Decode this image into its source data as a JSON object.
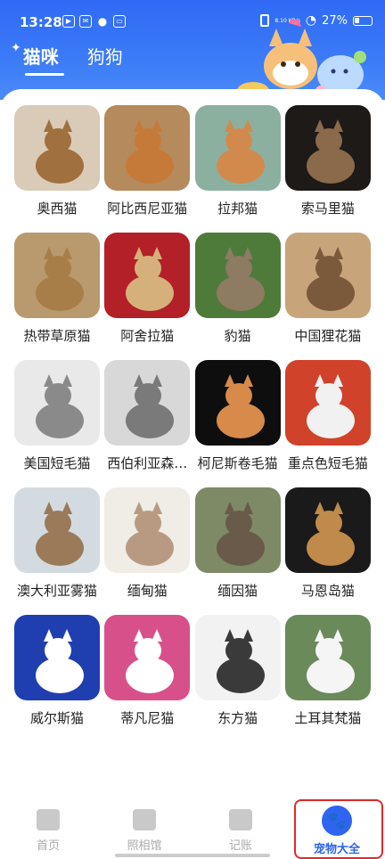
{
  "status_bar": {
    "time": "13:28",
    "net_speed": "8.10 KB/s",
    "battery": "27%"
  },
  "tabs": [
    {
      "label": "猫咪",
      "active": true
    },
    {
      "label": "狗狗",
      "active": false
    }
  ],
  "cats": [
    {
      "name": "奥西猫",
      "colors": [
        "#d9cbb8",
        "#a0703e"
      ]
    },
    {
      "name": "阿比西尼亚猫",
      "colors": [
        "#b58a5d",
        "#c57a3a"
      ]
    },
    {
      "name": "拉邦猫",
      "colors": [
        "#8bb0a0",
        "#d28a4c"
      ]
    },
    {
      "name": "索马里猫",
      "colors": [
        "#1d1a18",
        "#8a6a4b"
      ]
    },
    {
      "name": "热带草原猫",
      "colors": [
        "#b89a6e",
        "#a87e48"
      ]
    },
    {
      "name": "阿舍拉猫",
      "colors": [
        "#b32028",
        "#d6b07a"
      ]
    },
    {
      "name": "豹猫",
      "colors": [
        "#4e7b3a",
        "#8d7b62"
      ]
    },
    {
      "name": "中国狸花猫",
      "colors": [
        "#c8a47a",
        "#7a5a3a"
      ]
    },
    {
      "name": "美国短毛猫",
      "colors": [
        "#e9e9e9",
        "#8a8a8a"
      ]
    },
    {
      "name": "西伯利亚森…",
      "colors": [
        "#d8d8d8",
        "#7a7a7a"
      ]
    },
    {
      "name": "柯尼斯卷毛猫",
      "colors": [
        "#0e0e0e",
        "#d88a4a"
      ]
    },
    {
      "name": "重点色短毛猫",
      "colors": [
        "#d0432a",
        "#f1f1f1"
      ]
    },
    {
      "name": "澳大利亚雾猫",
      "colors": [
        "#d3dbe0",
        "#9a7a58"
      ]
    },
    {
      "name": "缅甸猫",
      "colors": [
        "#f0ece6",
        "#b89a82"
      ]
    },
    {
      "name": "缅因猫",
      "colors": [
        "#7e8a66",
        "#6a5a4a"
      ]
    },
    {
      "name": "马恩岛猫",
      "colors": [
        "#1a1a1a",
        "#c08a4a"
      ]
    },
    {
      "name": "威尔斯猫",
      "colors": [
        "#1f3fb0",
        "#ffffff"
      ]
    },
    {
      "name": "蒂凡尼猫",
      "colors": [
        "#d8508a",
        "#ffffff"
      ]
    },
    {
      "name": "东方猫",
      "colors": [
        "#f2f2f2",
        "#3a3a3a"
      ]
    },
    {
      "name": "土耳其梵猫",
      "colors": [
        "#6a8a5a",
        "#f5f5f5"
      ]
    }
  ],
  "bottom_nav": [
    {
      "label": "首页"
    },
    {
      "label": "照相馆"
    },
    {
      "label": "记账"
    },
    {
      "label": "宠物大全"
    }
  ],
  "colors": {
    "brand_blue": "#2f64f0",
    "highlight_red": "#e02828"
  }
}
